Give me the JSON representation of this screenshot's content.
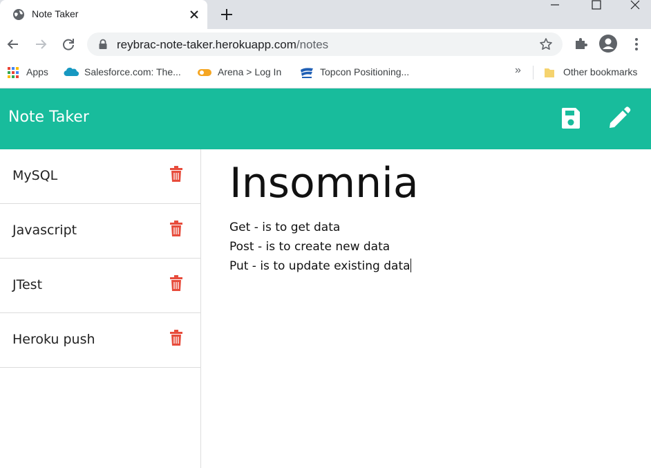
{
  "browser": {
    "tab_title": "Note Taker",
    "url_host": "reybrac-note-taker.herokuapp.com",
    "url_path": "/notes",
    "bookmarks": [
      {
        "label": "Apps",
        "icon": "apps-grid-icon"
      },
      {
        "label": "Salesforce.com: The...",
        "icon": "salesforce-cloud-icon"
      },
      {
        "label": "Arena > Log In",
        "icon": "arena-icon"
      },
      {
        "label": "Topcon Positioning...",
        "icon": "topcon-icon"
      }
    ],
    "more_bookmarks": "»",
    "other_bookmarks": "Other bookmarks"
  },
  "app": {
    "title": "Note Taker",
    "accent_color": "#18bc9c",
    "delete_color": "#e74c3c"
  },
  "notes": [
    {
      "title": "MySQL"
    },
    {
      "title": "Javascript"
    },
    {
      "title": "JTest"
    },
    {
      "title": "Heroku push"
    }
  ],
  "active_note": {
    "title": "Insomnia",
    "lines": [
      "Get - is to get data",
      "Post - is to create new data",
      "Put - is to update existing data"
    ]
  }
}
